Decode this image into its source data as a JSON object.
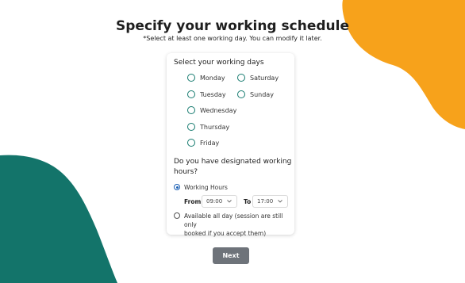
{
  "header": {
    "title": "Specify your working schedule",
    "subtitle": "*Select at least one working day. You can modify it later."
  },
  "days_section": {
    "title": "Select your working days",
    "days": [
      {
        "label": "Monday",
        "selected": false
      },
      {
        "label": "Saturday",
        "selected": false
      },
      {
        "label": "Tuesday",
        "selected": false
      },
      {
        "label": "Sunday",
        "selected": false
      },
      {
        "label": "Wednesday",
        "selected": false
      },
      {
        "label": "Thursday",
        "selected": false
      },
      {
        "label": "Friday",
        "selected": false
      }
    ]
  },
  "hours_section": {
    "question_line1": "Do you have designated working",
    "question_line2": "hours?",
    "option_working_hours": "Working Hours",
    "option_working_hours_selected": true,
    "from_label": "From",
    "from_value": "09:00",
    "to_label": "To",
    "to_value": "17:00",
    "option_all_day_line1": "Available all day (session are still only",
    "option_all_day_line2": "booked if you accept them)",
    "option_all_day_selected": false
  },
  "actions": {
    "next_label": "Next"
  },
  "colors": {
    "orange_blob": "#f7a21b",
    "teal_blob": "#13746a",
    "radio_accent": "#1a5fb4",
    "button_bg": "#6e737a"
  }
}
